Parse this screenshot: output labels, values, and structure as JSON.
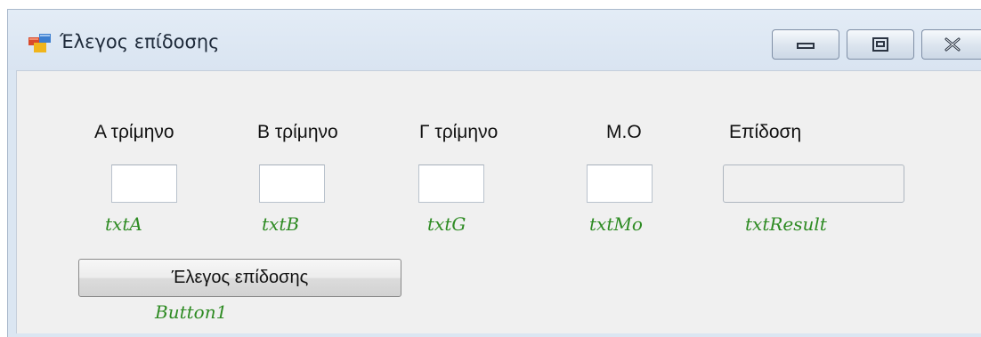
{
  "window": {
    "title": "Έλεγος επίδοσης"
  },
  "form": {
    "labels": {
      "a": "Α τρίμηνο",
      "b": "Β τρίμηνο",
      "g": "Γ τρίμηνο",
      "mo": "Μ.Ο",
      "result": "Επίδοση"
    },
    "fields": {
      "txtA": "",
      "txtB": "",
      "txtG": "",
      "txtMo": "",
      "txtResult": ""
    },
    "button_label": "Έλεγος επίδοσης"
  },
  "annotations": {
    "txtA": "txtA",
    "txtB": "txtB",
    "txtG": "txtG",
    "txtMo": "txtMo",
    "txtResult": "txtResult",
    "button1": "Button1"
  },
  "colors": {
    "annotation": "#2e8b23",
    "client_background": "#f0f0f0",
    "frame": "#dbe6f2"
  }
}
